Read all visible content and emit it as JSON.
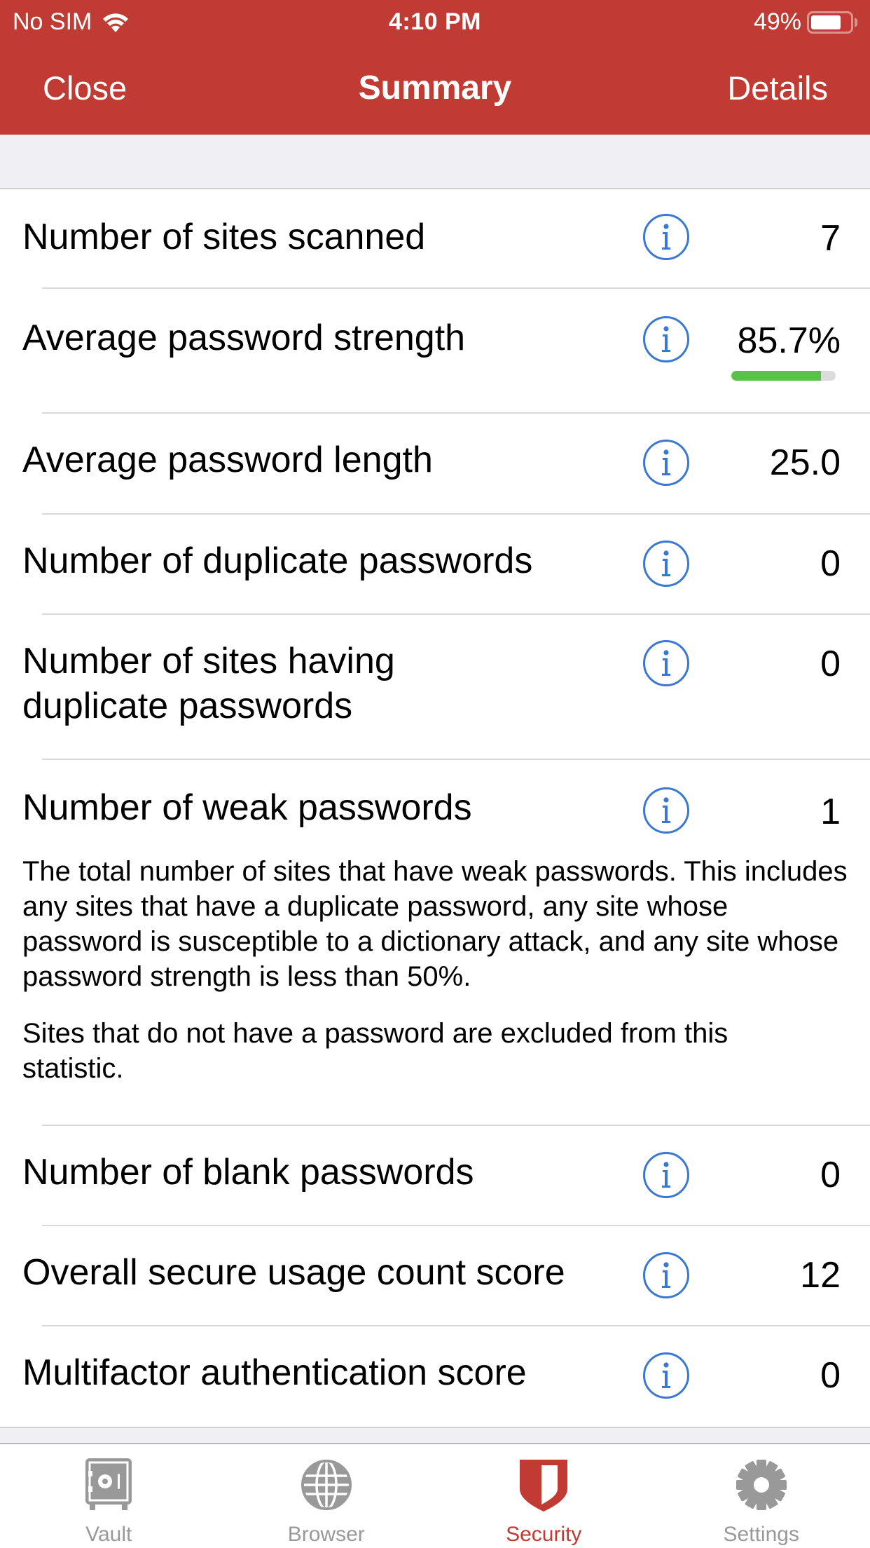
{
  "status_bar": {
    "carrier": "No SIM",
    "wifi_icon": "wifi-icon",
    "time": "4:10 PM",
    "battery_percent_label": "49%",
    "battery_level": 0.49
  },
  "nav": {
    "left_button": "Close",
    "title": "Summary",
    "right_button": "Details"
  },
  "colors": {
    "brand_red": "#C03B33",
    "info_blue": "#3B78D0",
    "strength_green": "#5AC24A",
    "inactive_tab": "#999999"
  },
  "stats": [
    {
      "label": "Number of sites scanned",
      "value": "7",
      "info_icon": "info-icon"
    },
    {
      "label": "Average password strength",
      "value": "85.7%",
      "progress": 0.857,
      "info_icon": "info-icon"
    },
    {
      "label": "Average password length",
      "value": "25.0",
      "info_icon": "info-icon"
    },
    {
      "label": "Number of duplicate passwords",
      "value": "0",
      "info_icon": "info-icon"
    },
    {
      "label": "Number of sites having duplicate passwords",
      "value": "0",
      "info_icon": "info-icon"
    },
    {
      "label": "Number of weak passwords",
      "value": "1",
      "info_icon": "info-icon",
      "description": [
        "The total number of sites that have weak passwords. This includes any sites that have a duplicate password, any site whose password is susceptible to a dictionary attack, and any site whose password strength is less than 50%.",
        "Sites that do not have a password are excluded from this statistic."
      ]
    },
    {
      "label": "Number of blank passwords",
      "value": "0",
      "info_icon": "info-icon"
    },
    {
      "label": "Overall secure usage count score",
      "value": "12",
      "info_icon": "info-icon"
    },
    {
      "label": "Multifactor authentication score",
      "value": "0",
      "info_icon": "info-icon"
    }
  ],
  "tabs": [
    {
      "label": "Vault",
      "icon": "vault-icon",
      "active": false
    },
    {
      "label": "Browser",
      "icon": "globe-icon",
      "active": false
    },
    {
      "label": "Security",
      "icon": "shield-icon",
      "active": true
    },
    {
      "label": "Settings",
      "icon": "gear-icon",
      "active": false
    }
  ]
}
